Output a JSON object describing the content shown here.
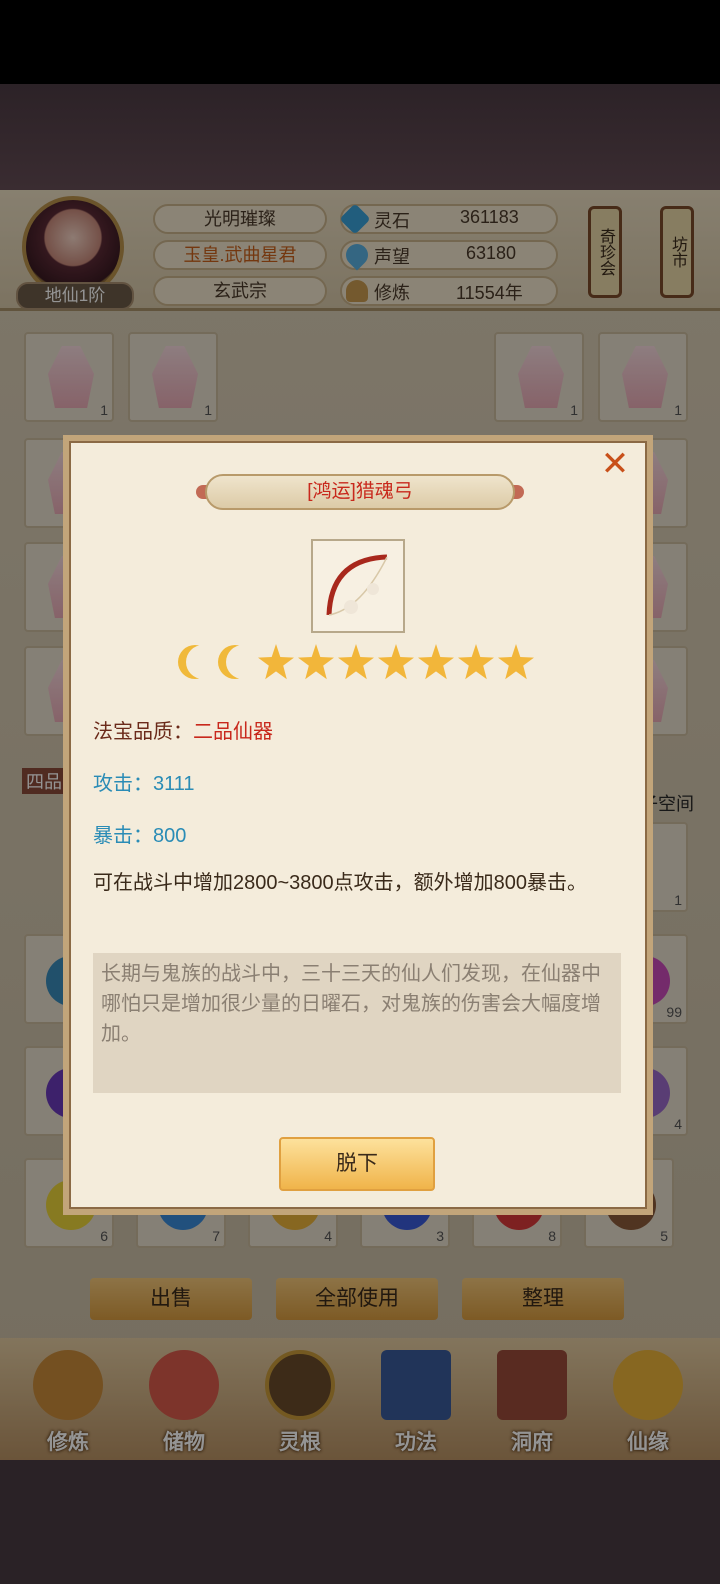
{
  "header": {
    "player_name": "光明璀璨",
    "title": "玉皇.武曲星君",
    "sect": "玄武宗",
    "rank": "地仙1阶",
    "resources": [
      {
        "label": "灵石",
        "value": "361183",
        "icon": "spirit-stone-icon",
        "color": "#3aa0d8"
      },
      {
        "label": "声望",
        "value": "63180",
        "icon": "prestige-icon",
        "color": "#5ab0e0"
      },
      {
        "label": "修炼",
        "value": "11554年",
        "icon": "meditation-icon",
        "color": "#c89a50"
      }
    ],
    "lantern_treasure": "奇珍会",
    "lantern_market": "坊市"
  },
  "inventory": {
    "counts_top": [
      "1",
      "1",
      "1",
      "1"
    ],
    "side_left": "四品",
    "side_right": "子空间",
    "orb_counts": [
      "6",
      "7",
      "4",
      "3",
      "8",
      "5"
    ],
    "right_counts": [
      "1",
      "99",
      "4"
    ]
  },
  "actions": {
    "sell": "出售",
    "use_all": "全部使用",
    "organize": "整理"
  },
  "nav": [
    {
      "label": "修炼",
      "icon": "cultivate-icon"
    },
    {
      "label": "储物",
      "icon": "storage-bag-icon"
    },
    {
      "label": "灵根",
      "icon": "spirit-root-icon"
    },
    {
      "label": "功法",
      "icon": "technique-book-icon"
    },
    {
      "label": "洞府",
      "icon": "cave-dwelling-icon"
    },
    {
      "label": "仙缘",
      "icon": "immortal-fate-icon"
    }
  ],
  "modal": {
    "item_name": "[鸿运]猎魂弓",
    "moons": 2,
    "stars": 7,
    "quality_label": "法宝品质：",
    "quality_value": "二品仙器",
    "attack": "攻击：3111",
    "crit": "暴击：800",
    "description": "可在战斗中增加2800~3800点攻击，额外增加800暴击。",
    "lore": "长期与鬼族的战斗中，三十三天的仙人们发现，在仙器中哪怕只是增加很少量的日曜石，对鬼族的伤害会大幅度增加。",
    "unequip": "脱下",
    "close_glyph": "✕"
  }
}
